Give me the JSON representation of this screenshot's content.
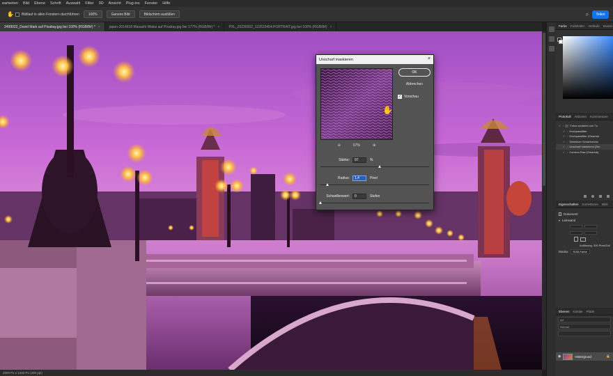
{
  "menubar": {
    "items": [
      "earbeiten",
      "Bild",
      "Ebene",
      "Schrift",
      "Auswahl",
      "Filter",
      "3D",
      "Ansicht",
      "Plug-ins",
      "Fenster",
      "Hilfe"
    ]
  },
  "options": {
    "scroll_all_label": "Bildlauf in allen Fenstern durchführen",
    "zoom_label": "100%",
    "fit_label": "Ganzes Bild",
    "fill_label": "Bildschirm ausfüllen",
    "share_label": "Teilen"
  },
  "tabs": [
    {
      "label": "2499022_David Mark auf Pixabay.jpg bei 100% (RGB/8#) *",
      "active": true
    },
    {
      "label": "japan-2014618 Masashi Wakui auf Pixabay.jpg bei 177% (RGB/8#) *",
      "active": false
    },
    {
      "label": "PXL_20230922_122623454.PORTRAIT.jpg bei 100% (RGB/8#)",
      "active": false
    }
  ],
  "status": {
    "text": "2000 Px x 1333 Px (300 ppi)"
  },
  "dialog": {
    "title": "Unscharf maskieren",
    "ok_label": "OK",
    "cancel_label": "Abbrechen",
    "preview_label": "Vorschau",
    "zoom_out": "⊖",
    "zoom_value": "67%",
    "zoom_in": "⊕",
    "params": [
      {
        "label": "Stärke:",
        "value": "97",
        "unit": "%",
        "slider_fraction": 0.55
      },
      {
        "label": "Radius:",
        "value": "1,4",
        "unit": "Pixel",
        "slider_fraction": 0.07
      },
      {
        "label": "Schwellenwert:",
        "value": "0",
        "unit": "Stufen",
        "slider_fraction": 0.0
      }
    ]
  },
  "panels": {
    "color_tabs": [
      "Farbe",
      "Farbfelder",
      "Verläufe",
      "Muster"
    ],
    "history_tabs": [
      "Protokoll",
      "Aktionen",
      "Kommentare"
    ],
    "history_items": [
      {
        "label": "Fotos schärfen von Tu",
        "level": 0
      },
      {
        "label": "Hochpassfilter",
        "level": 1
      },
      {
        "label": "Hochpassfilter (Smartob",
        "level": 1
      },
      {
        "label": "Selektiver Scharfzeichn",
        "level": 1
      },
      {
        "label": "Unscharf maskieren (Sm",
        "level": 1
      },
      {
        "label": "Camera Raw (Smartobj",
        "level": 1
      }
    ],
    "props_tabs": [
      "Eigenschaften",
      "Korrekturen",
      "Bibli"
    ],
    "props_document": "Dokument",
    "props_canvas": "Leinwand",
    "props_resolution": "Auflösung: 300 Pixel/Zoll",
    "props_mode_label": "Modus",
    "props_mode_value": "RGB-Farbe",
    "layers_tabs": [
      "Ebenen",
      "Kanäle",
      "Pfade"
    ],
    "layer_kind": "Art",
    "layer_mode": "Normal",
    "layer_name": "Hintergrund",
    "layer_lock": "🔒"
  }
}
